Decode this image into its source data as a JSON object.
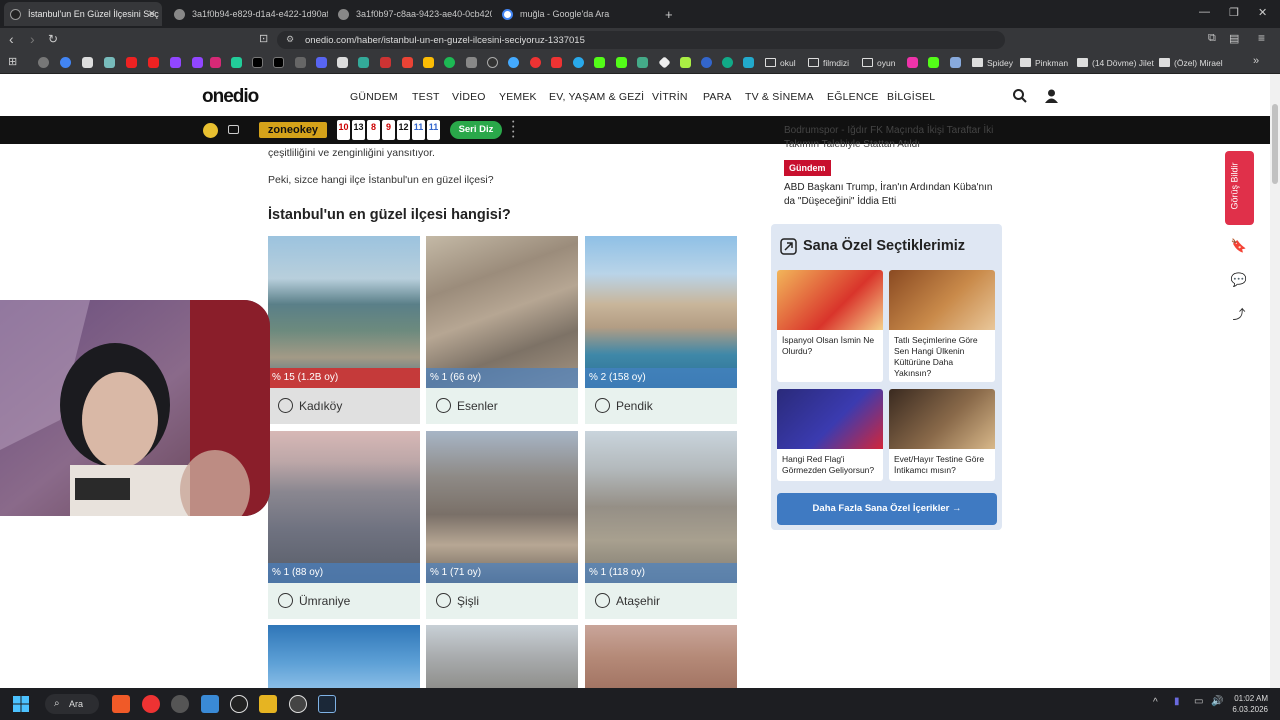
{
  "browser": {
    "tabs": [
      {
        "title": "İstanbul'un En Güzel İlçesini Seç"
      },
      {
        "title": "3a1f0b94-e829-d1a4-e422-1d90afb"
      },
      {
        "title": "3a1f0b97-c8aa-9423-ae40-0cb4209"
      },
      {
        "title": "muğla - Google'da Ara"
      }
    ],
    "url": "onedio.com/haber/istanbul-un-en-guzel-ilcesini-seciyoruz-1337015",
    "bookmarks": {
      "okul": "okul",
      "filmdizi": "filmdizi",
      "oyun": "oyun",
      "spidey": "Spidey",
      "pinkman": "Pinkman",
      "jilet": "(14 Dövme) Jilet",
      "mirael": "(Özel) Mirael"
    }
  },
  "site": {
    "logo": "onedio",
    "nav": [
      "GÜNDEM",
      "TEST",
      "VİDEO",
      "YEMEK",
      "EV, YAŞAM & GEZİ",
      "VİTRİN",
      "PARA",
      "TV & SİNEMA",
      "EĞLENCE",
      "BİLGİSEL"
    ],
    "gamebar": {
      "logo": "zoneokey",
      "cards": [
        "10",
        "13",
        "8",
        "9",
        "12",
        "11",
        "11"
      ],
      "button": "Seri Diz"
    }
  },
  "article": {
    "para1": "çeşitliliğini ve zenginliğini yansıtıyor.",
    "para2": "Peki, sizce hangi ilçe İstanbul'un en güzel ilçesi?",
    "poll_title": "İstanbul'un en güzel ilçesi hangisi?",
    "options": [
      {
        "name": "Kadıköy",
        "result": "% 15 (1.2B oy)",
        "percent": 15
      },
      {
        "name": "Esenler",
        "result": "% 1 (66 oy)",
        "percent": 1
      },
      {
        "name": "Pendik",
        "result": "% 2 (158 oy)",
        "percent": 2
      },
      {
        "name": "Ümraniye",
        "result": "% 1 (88 oy)",
        "percent": 1
      },
      {
        "name": "Şişli",
        "result": "% 1 (71 oy)",
        "percent": 1
      },
      {
        "name": "Ataşehir",
        "result": "% 1 (118 oy)",
        "percent": 1
      }
    ]
  },
  "sidebar": {
    "news_top": "Bodrumspor - Iğdır FK Maçında İkişi Taraftar İki Takımın Talebiyle Stattan Atıldı",
    "news_cat": "Gündem",
    "news_title": "ABD Başkanı Trump, İran'ın Ardından Küba'nın da \"Düşeceğini\" İddia Etti",
    "special_title": "Sana Özel Seçtiklerimiz",
    "special_items": [
      {
        "caption": "İspanyol Olsan İsmin Ne Olurdu?"
      },
      {
        "caption": "Tatlı Seçimlerine Göre Sen Hangi Ülkenin Kültürüne Daha Yakınsın?"
      },
      {
        "caption": "Hangi Red Flag'i Görmezden Geliyorsun?"
      },
      {
        "caption": "Evet/Hayır Testine Göre İntikamcı mısın?"
      }
    ],
    "more_button": "Daha Fazla Sana Özel İçerikler  →",
    "feedback": "Görüş Bildir"
  },
  "taskbar": {
    "search": "Ara",
    "time": "01:02 AM",
    "date": "6.03.2026"
  }
}
